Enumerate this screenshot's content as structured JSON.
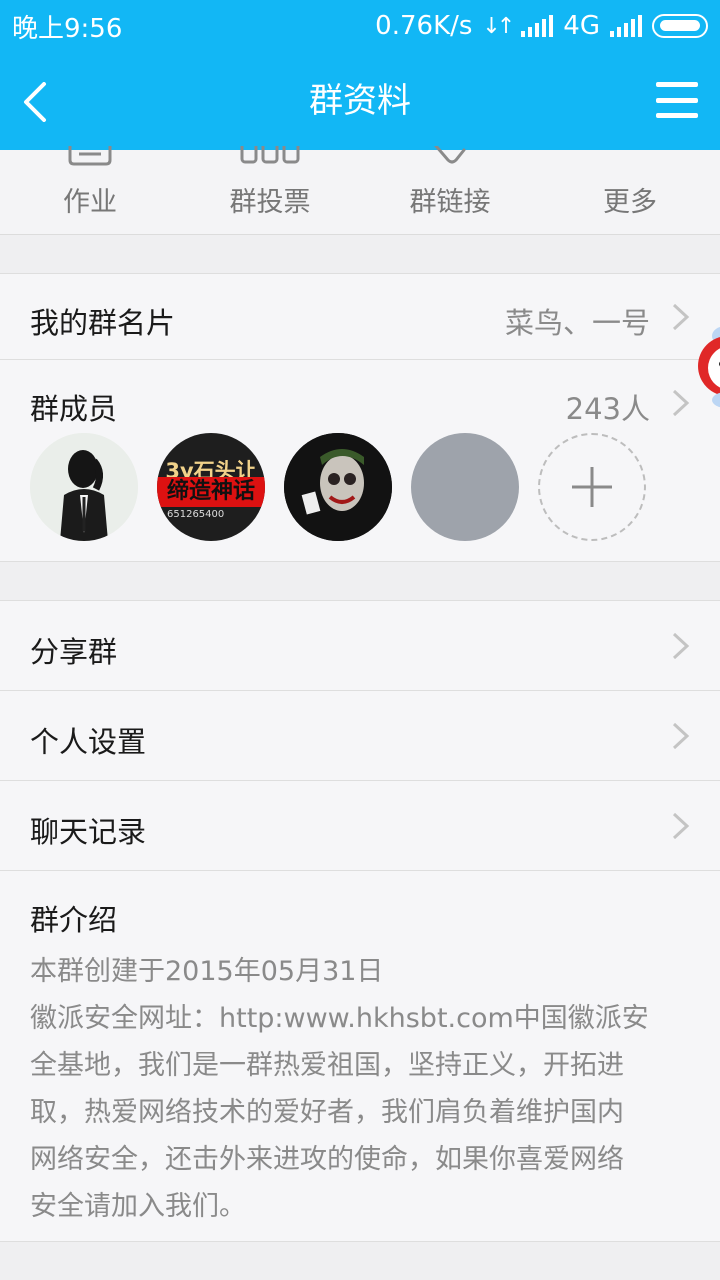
{
  "status": {
    "time": "晚上9:56",
    "speed": "0.76K/s",
    "network": "4G"
  },
  "header": {
    "title": "群资料",
    "accent": "#12b7f5"
  },
  "quick_actions": [
    {
      "label": "作业",
      "icon": "homework-icon"
    },
    {
      "label": "群投票",
      "icon": "vote-icon"
    },
    {
      "label": "群链接",
      "icon": "link-icon"
    },
    {
      "label": "更多",
      "icon": "more-icon"
    }
  ],
  "group_card": {
    "label": "我的群名片",
    "value": "菜鸟、一号"
  },
  "members": {
    "label": "群成员",
    "count": "243人",
    "avatars": [
      {
        "name": "member-avatar-suit",
        "banner_top": "3y石头让",
        "banner_mid": "缔造神话",
        "banner_num": "651265400"
      }
    ]
  },
  "menu": [
    {
      "label": "分享群"
    },
    {
      "label": "个人设置"
    },
    {
      "label": "聊天记录"
    }
  ],
  "intro": {
    "title": "群介绍",
    "lines": [
      "本群创建于2015年05月31日",
      "徽派安全网址：http:www.hkhsbt.com中国徽派安",
      "全基地，我们是一群热爱祖国，坚持正义，开拓进",
      "取，热爱网络技术的爱好者，我们肩负着维护国内",
      "网络安全，还击外来进攻的使命，如果你喜爱网络",
      "安全请加入我们。"
    ]
  }
}
